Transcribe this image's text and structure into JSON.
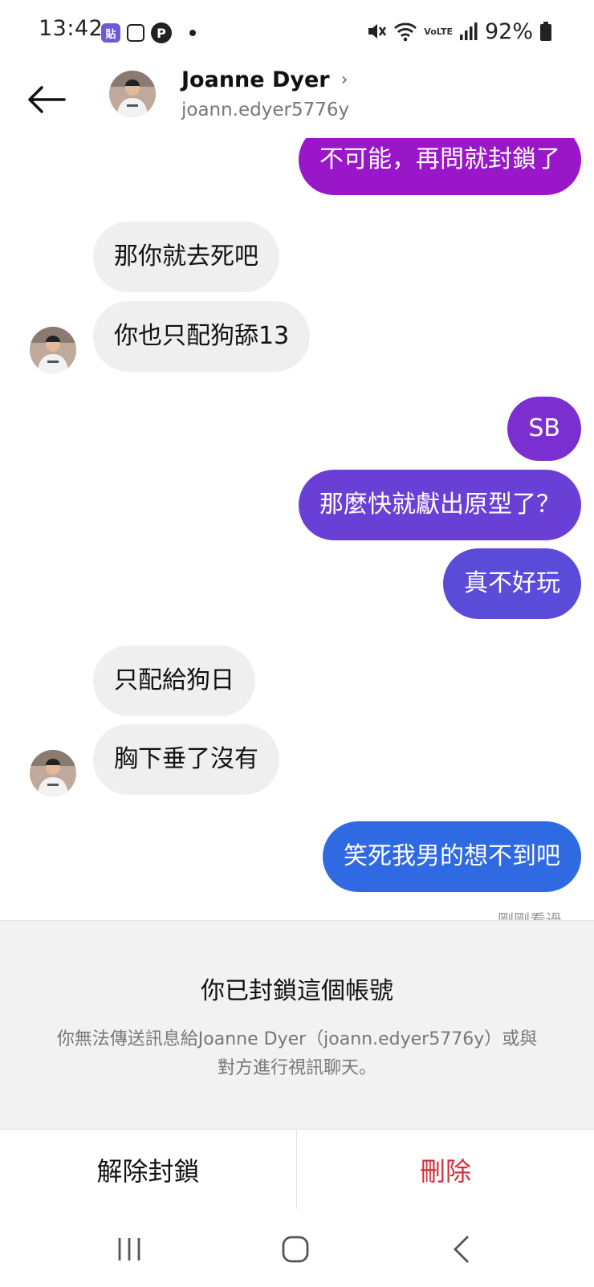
{
  "status_bar": {
    "time": "13:42",
    "app_icon_1": "貼",
    "app_icon_3": "P",
    "lte_label": "VoLTE",
    "battery": "92%",
    "icons": [
      "mute-icon",
      "wifi-icon",
      "signal-icon",
      "battery-icon"
    ]
  },
  "header": {
    "name": "Joanne Dyer",
    "chevron": "›",
    "handle": "joann.edyer5776y"
  },
  "messages": [
    {
      "side": "out",
      "text": "不可能，再問就封鎖了",
      "color": "#9a16c9"
    },
    {
      "side": "in",
      "text": "那你就去死吧"
    },
    {
      "side": "in",
      "text": "你也只配狗舔13"
    },
    {
      "side": "out",
      "text": "SB",
      "color": "#7b2fd0"
    },
    {
      "side": "out",
      "text": "那麼快就獻出原型了？",
      "color": "#6a3fd6"
    },
    {
      "side": "out",
      "text": "真不好玩",
      "color": "#5a4bd8"
    },
    {
      "side": "in",
      "text": "只配給狗日"
    },
    {
      "side": "in",
      "text": "胸下垂了沒有"
    },
    {
      "side": "out",
      "text": "笑死我男的想不到吧",
      "color": "#2f6ae3"
    }
  ],
  "seen_label": "剛剛看過",
  "blocked": {
    "title": "你已封鎖這個帳號",
    "description": "你無法傳送訊息給Joanne Dyer（joann.edyer5776y）或與對方進行視訊聊天。"
  },
  "actions": {
    "unblock": "解除封鎖",
    "delete": "刪除"
  },
  "colors": {
    "delete": "#d92b3a",
    "incoming_bubble": "#efefef"
  }
}
